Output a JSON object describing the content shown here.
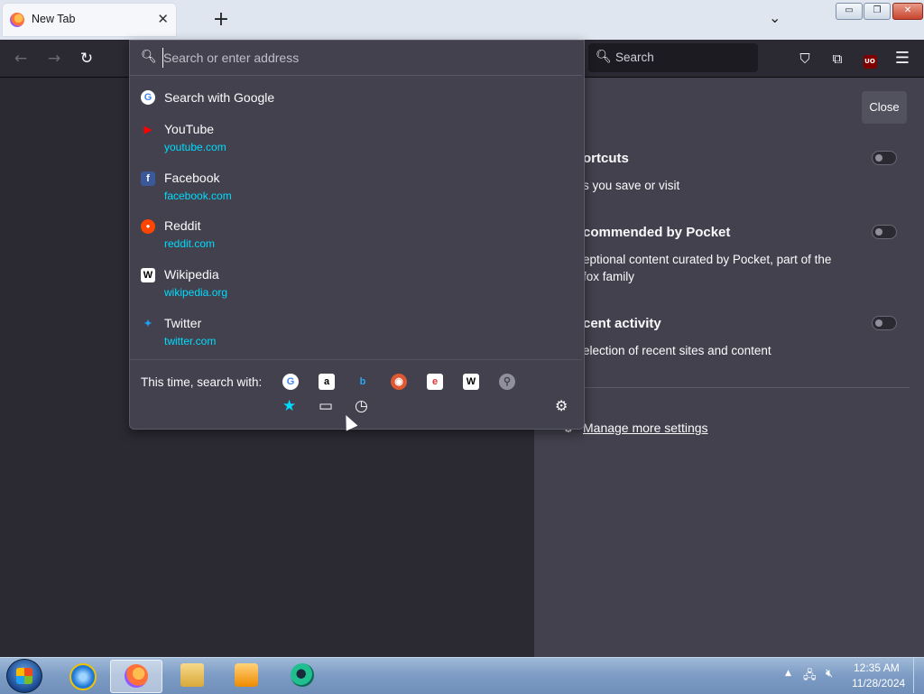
{
  "tab": {
    "title": "New Tab",
    "close_glyph": "✕"
  },
  "new_tab_glyph": "+",
  "list_tabs_glyph": "⌄",
  "window_controls": {
    "minimize": "▭",
    "maximize": "❐",
    "close": "✕"
  },
  "toolbar": {
    "back_glyph": "←",
    "forward_glyph": "→",
    "reload_glyph": "↻",
    "search_placeholder": "Search",
    "pocket_glyph": "⛉",
    "extensions_glyph": "⧉",
    "ublock_label": "UO",
    "menu_glyph": "☰"
  },
  "urlbar": {
    "placeholder": "Search or enter address"
  },
  "dropdown": {
    "search_with": "Search with Google",
    "results": [
      {
        "title": "YouTube",
        "url": "youtube.com",
        "icon": "youtube-icon",
        "color": "#ff0000",
        "glyph": "▶"
      },
      {
        "title": "Facebook",
        "url": "facebook.com",
        "icon": "facebook-icon",
        "color": "#3b5998",
        "glyph": "f"
      },
      {
        "title": "Reddit",
        "url": "reddit.com",
        "icon": "reddit-icon",
        "color": "#ff4500",
        "glyph": "●"
      },
      {
        "title": "Wikipedia",
        "url": "wikipedia.org",
        "icon": "wikipedia-icon",
        "color": "#ffffff",
        "glyph": "W"
      },
      {
        "title": "Twitter",
        "url": "twitter.com",
        "icon": "twitter-icon",
        "color": "#1da1f2",
        "glyph": "✦"
      }
    ],
    "oneoff_label": "This time, search with:",
    "oneoff_engines": [
      {
        "name": "google-icon",
        "glyph": "G",
        "bg": "#ffffff",
        "fg": "#4285f4"
      },
      {
        "name": "amazon-icon",
        "glyph": "a",
        "bg": "#ffffff",
        "fg": "#000000"
      },
      {
        "name": "bing-icon",
        "glyph": "b",
        "bg": "#42414d",
        "fg": "#2aa7f0"
      },
      {
        "name": "duckduckgo-icon",
        "glyph": "◉",
        "bg": "#de5833",
        "fg": "#ffffff"
      },
      {
        "name": "ebay-icon",
        "glyph": "e",
        "bg": "#ffffff",
        "fg": "#e53238"
      },
      {
        "name": "wikipedia-icon",
        "glyph": "W",
        "bg": "#ffffff",
        "fg": "#000000"
      },
      {
        "name": "search-engine-icon",
        "glyph": "⚲",
        "bg": "#8f8f9d",
        "fg": "#42414d"
      }
    ],
    "local_modes": [
      {
        "name": "bookmarks-icon",
        "glyph": "★",
        "color": "#00ddff"
      },
      {
        "name": "tabs-icon",
        "glyph": "▭",
        "color": "#fbfbfe"
      },
      {
        "name": "history-icon",
        "glyph": "◷",
        "color": "#fbfbfe"
      }
    ],
    "settings_glyph": "⚙"
  },
  "panel": {
    "close_label": "Close",
    "sections": [
      {
        "title": "ortcuts",
        "desc": "s you save or visit"
      },
      {
        "title": "commended by Pocket",
        "desc": "eptional content curated by Pocket, part of the\nfox family"
      },
      {
        "title": "cent activity",
        "desc": "election of recent sites and content"
      }
    ],
    "manage_label": "Manage more settings"
  },
  "taskbar": {
    "time": "12:35 AM",
    "date": "11/28/2024"
  },
  "colors": {
    "accent": "#00ddff",
    "panel_bg": "#42414d",
    "page_bg": "#2b2a33"
  }
}
